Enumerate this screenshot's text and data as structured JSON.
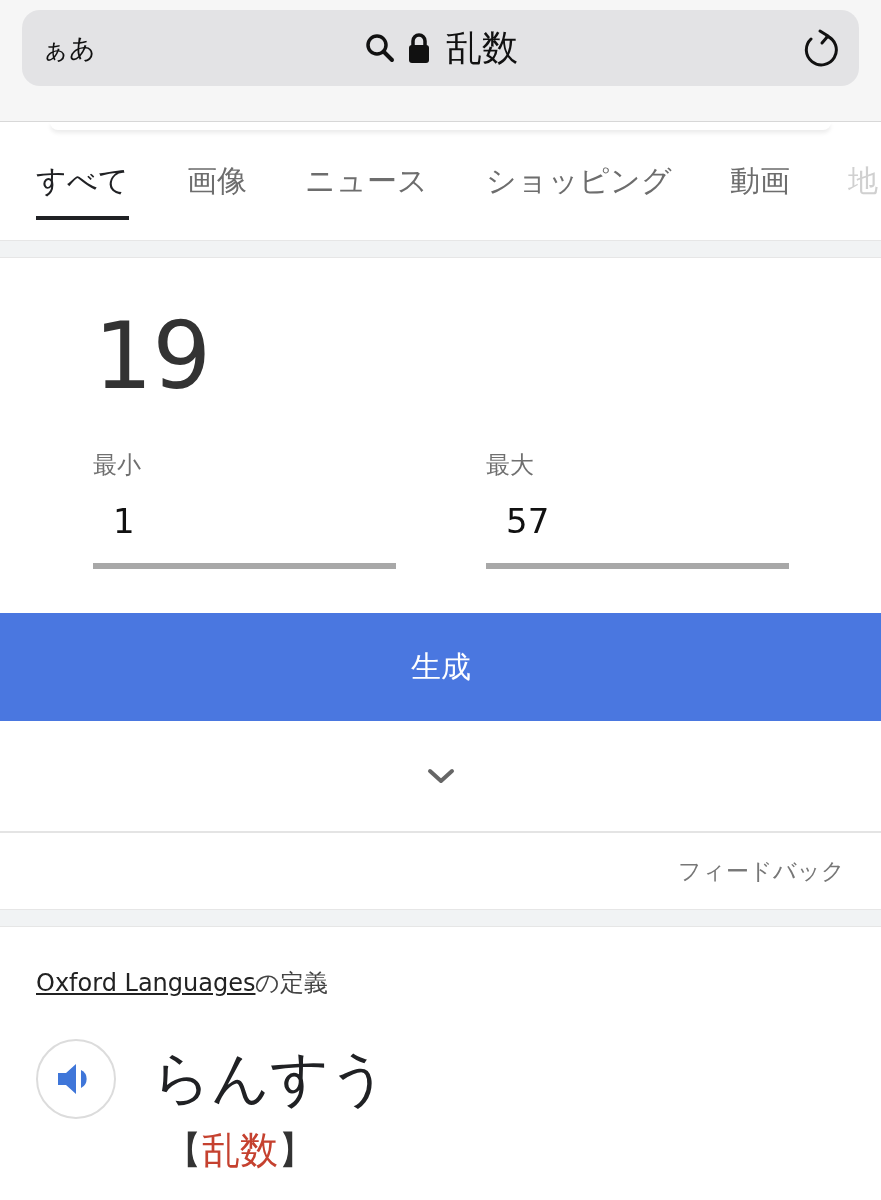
{
  "browser": {
    "text_size_button": "ぁあ",
    "address": "乱数"
  },
  "tabs": [
    {
      "label": "すべて",
      "selected": true
    },
    {
      "label": "画像",
      "selected": false
    },
    {
      "label": "ニュース",
      "selected": false
    },
    {
      "label": "ショッピング",
      "selected": false
    },
    {
      "label": "動画",
      "selected": false
    },
    {
      "label": "地",
      "selected": false
    }
  ],
  "random_number": {
    "result": "19",
    "min_label": "最小",
    "min_value": "1",
    "max_label": "最大",
    "max_value": "57",
    "generate_button": "生成",
    "feedback": "フィードバック"
  },
  "dictionary": {
    "source_link": "Oxford Languages",
    "source_suffix": "の定義",
    "reading": "らんすう",
    "kanji_open": "【",
    "kanji": "乱数",
    "kanji_close": "】"
  }
}
